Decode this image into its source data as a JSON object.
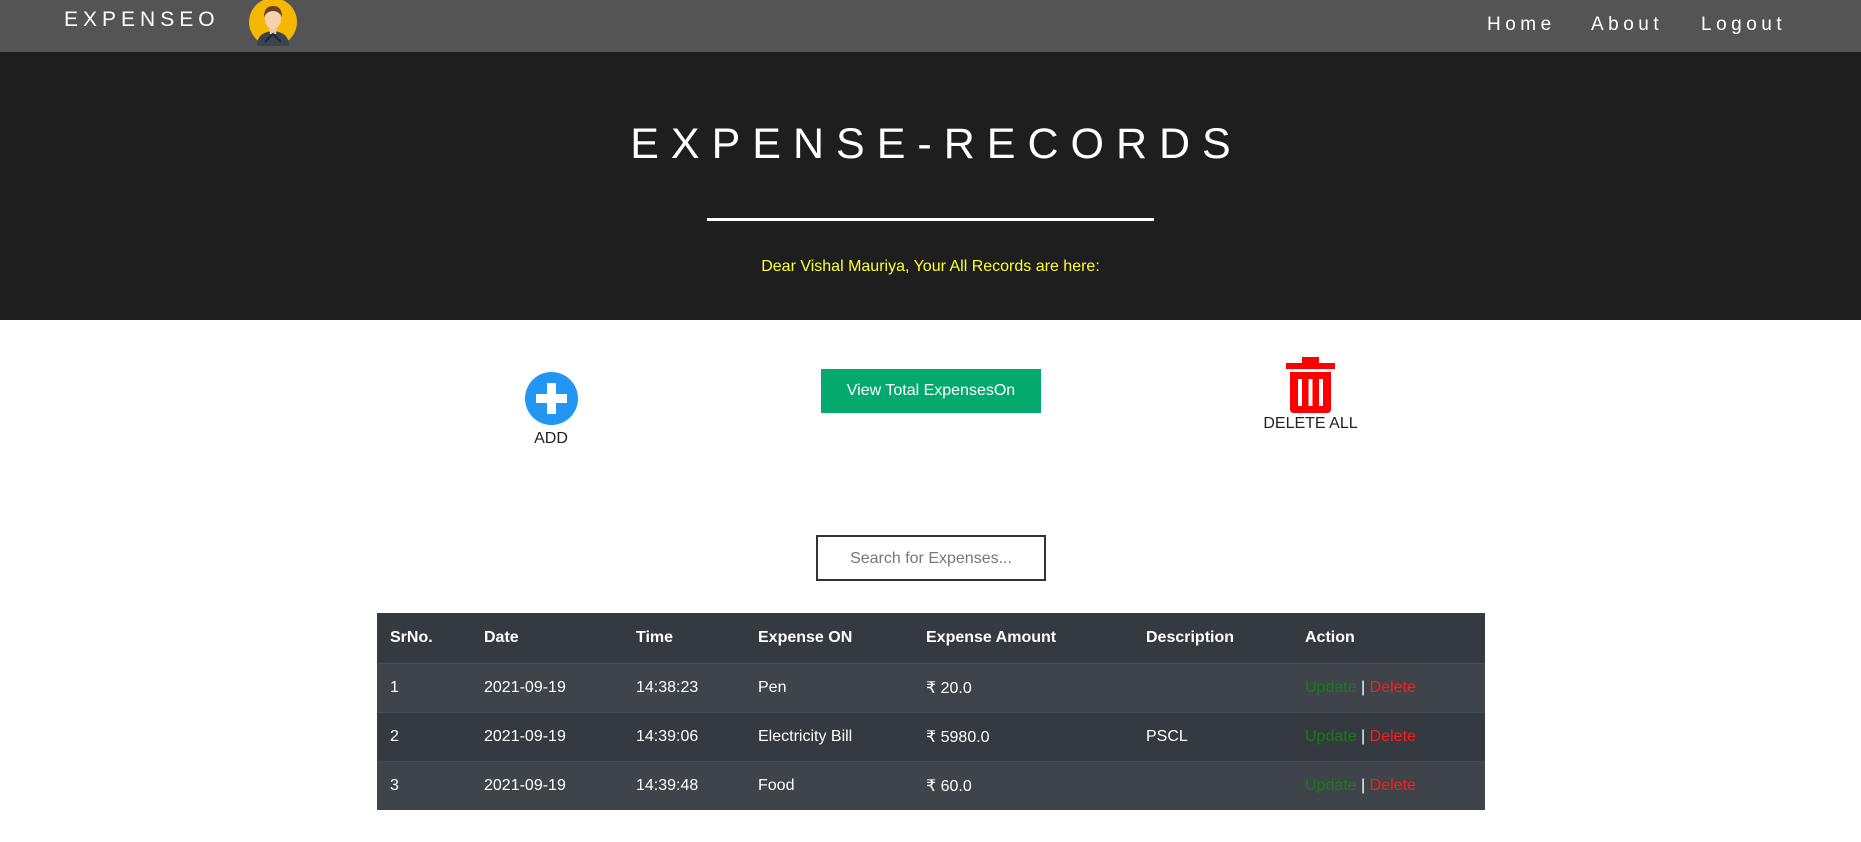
{
  "navbar": {
    "brand": "EXPENSEO",
    "links": {
      "home": "Home",
      "about": "About",
      "logout": "Logout"
    }
  },
  "hero": {
    "title": "EXPENSE-RECORDS",
    "greeting": "Dear Vishal Mauriya, Your All Records are here:"
  },
  "actions": {
    "add_label": "ADD",
    "view_total_label": "View Total ExpensesOn",
    "delete_all_label": "DELETE ALL"
  },
  "search": {
    "placeholder": "Search for Expenses..."
  },
  "table": {
    "headers": [
      "SrNo.",
      "Date",
      "Time",
      "Expense ON",
      "Expense Amount",
      "Description",
      "Action"
    ],
    "rows": [
      {
        "srno": "1",
        "date": "2021-09-19",
        "time": "14:38:23",
        "expense_on": "Pen",
        "amount": "₹ 20.0",
        "description": "",
        "update": "Update",
        "sep": "|",
        "delete": "Delete"
      },
      {
        "srno": "2",
        "date": "2021-09-19",
        "time": "14:39:06",
        "expense_on": "Electricity Bill",
        "amount": "₹ 5980.0",
        "description": "PSCL",
        "update": "Update",
        "sep": "|",
        "delete": "Delete"
      },
      {
        "srno": "3",
        "date": "2021-09-19",
        "time": "14:39:48",
        "expense_on": "Food",
        "amount": "₹ 60.0",
        "description": "",
        "update": "Update",
        "sep": "|",
        "delete": "Delete"
      }
    ]
  },
  "colors": {
    "navbar": "#545454",
    "hero": "#1e1e1e",
    "greeting": "#ffff2e",
    "add_icon": "#2196f3",
    "view_button": "#04aa6d",
    "trash_icon": "#ff0000",
    "table_bg": "#343a40",
    "update_link": "#1a7a1a",
    "delete_link": "#ff1a1a"
  },
  "icons": {
    "avatar": "user-avatar",
    "add": "plus-circle-icon",
    "delete_all": "trash-icon"
  }
}
